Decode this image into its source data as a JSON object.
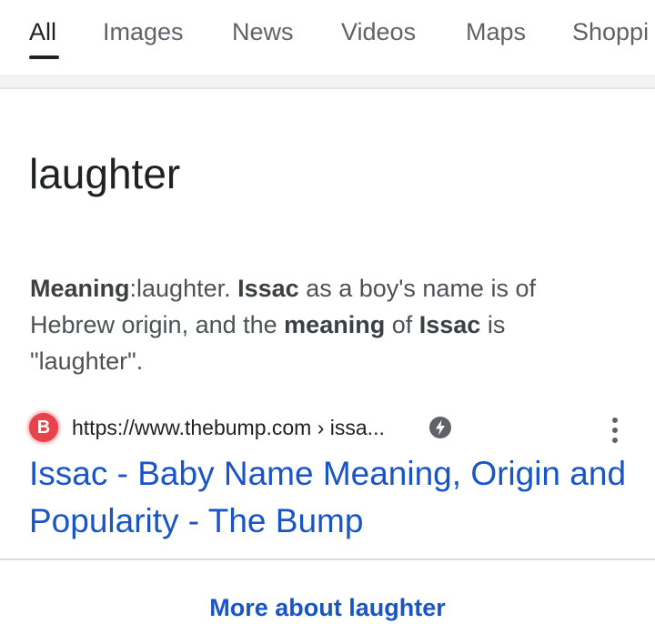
{
  "tabs": [
    {
      "label": "All",
      "active": true
    },
    {
      "label": "Images",
      "active": false
    },
    {
      "label": "News",
      "active": false
    },
    {
      "label": "Videos",
      "active": false
    },
    {
      "label": "Maps",
      "active": false
    },
    {
      "label": "Shoppi",
      "active": false
    }
  ],
  "answer": {
    "title": "laughter",
    "snippet": {
      "p1_bold": "Meaning",
      "p2": ":laughter. ",
      "p3_bold": "Issac",
      "p4": " as a boy's name is of Hebrew origin, and the ",
      "p5_bold": "meaning",
      "p6": " of ",
      "p7_bold": "Issac",
      "p8": " is \"laughter\"."
    },
    "source": {
      "favicon_letter": "B",
      "favicon_color": "#e9424b",
      "url": "https://www.thebump.com › issa...",
      "amp_icon": "amp-lightning-icon",
      "menu_icon": "more-vert-icon"
    },
    "result_title": "Issac - Baby Name Meaning, Origin and Popularity - The Bump",
    "link_color": "#1a55c5"
  },
  "more_about": "More about laughter"
}
